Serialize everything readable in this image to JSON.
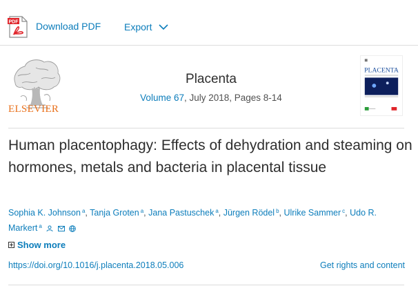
{
  "toolbar": {
    "download_label": "Download PDF",
    "export_label": "Export",
    "accent": "#0c7dbb",
    "pdf_icon_color": "#e0242a",
    "pdf_icon_text": "PDF"
  },
  "publication": {
    "publisher": "ELSEVIER",
    "publisher_color": "#e9711c",
    "journal": "Placenta",
    "volume_link": "Volume 67",
    "volume_rest": ", July 2018, Pages 8-14",
    "cover_title": "PLACENTA"
  },
  "article": {
    "title": "Human placentophagy: Effects of dehydration and steaming on hormones, metals and bacteria in placental tissue",
    "authors": [
      {
        "name": "Sophia K. Johnson",
        "sup": "a"
      },
      {
        "name": "Tanja Groten",
        "sup": "a"
      },
      {
        "name": "Jana Pastuschek",
        "sup": "a"
      },
      {
        "name": "Jürgen Rödel",
        "sup": "b"
      },
      {
        "name": "Ulrike Sammer",
        "sup": "c"
      },
      {
        "name": "Udo R. Markert",
        "sup": "a"
      }
    ],
    "show_more": "Show more",
    "doi": "https://doi.org/10.1016/j.placenta.2018.05.006",
    "rights": "Get rights and content"
  }
}
